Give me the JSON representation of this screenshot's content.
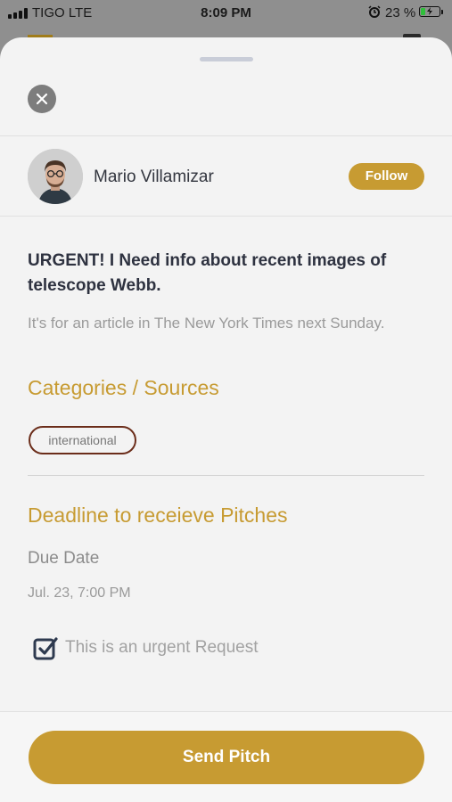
{
  "status_bar": {
    "carrier": "TIGO  LTE",
    "time": "8:09 PM",
    "battery_percent": "23 %",
    "icons": [
      "signal-icon",
      "alarm-icon",
      "battery-charging-icon"
    ]
  },
  "sheet": {
    "close_icon": "close-icon",
    "user": {
      "name": "Mario Villamizar",
      "follow_label": "Follow"
    },
    "request": {
      "title": "URGENT! I Need info about recent images of telescope Webb.",
      "description": "It's for an article in The New York Times next Sunday."
    },
    "categories": {
      "title": "Categories / Sources",
      "chips": [
        "international"
      ]
    },
    "deadline": {
      "title": "Deadline to receieve Pitches",
      "due_label": "Due Date",
      "due_value": "Jul. 23, 7:00 PM"
    },
    "urgent": {
      "checked": true,
      "label": "This is an urgent Request"
    },
    "send_pitch_label": "Send Pitch"
  },
  "colors": {
    "accent": "#c79b32",
    "chip_border": "#6b2d1a",
    "sheet_bg": "#f3f3f3",
    "overlay": "#8f8f8f"
  }
}
